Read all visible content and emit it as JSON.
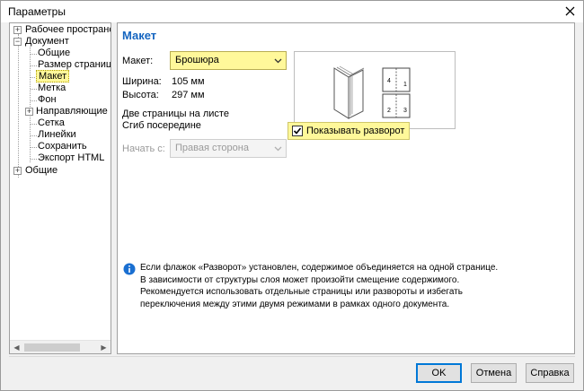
{
  "window": {
    "title": "Параметры"
  },
  "tree": {
    "items": [
      {
        "label": "Рабочее пространство",
        "expander": "+"
      },
      {
        "label": "Документ",
        "expander": "−"
      },
      {
        "label": "Общие"
      },
      {
        "label": "Размер страницы"
      },
      {
        "label": "Макет",
        "selected": true
      },
      {
        "label": "Метка"
      },
      {
        "label": "Фон"
      },
      {
        "label": "Направляющие",
        "expander": "+"
      },
      {
        "label": "Сетка"
      },
      {
        "label": "Линейки"
      },
      {
        "label": "Сохранить"
      },
      {
        "label": "Экспорт HTML"
      },
      {
        "label": "Общие",
        "expander": "+"
      }
    ]
  },
  "main": {
    "title": "Макет",
    "layout_label": "Макет:",
    "layout_value": "Брошюра",
    "width_label": "Ширина:",
    "width_value": "105 мм",
    "height_label": "Высота:",
    "height_value": "297 мм",
    "line1": "Две страницы на листе",
    "line2": "Сгиб посередине",
    "start_label": "Начать с:",
    "start_value": "Правая сторона",
    "show_spread_label": "Показывать разворот",
    "show_spread_checked": true,
    "preview": {
      "p1": "4",
      "p2": "1",
      "p3": "2",
      "p4": "3"
    },
    "info": [
      "Если флажок «Разворот» установлен, содержимое объединяется на одной странице.",
      "В зависимости от структуры слоя может произойти смещение содержимого.",
      "Рекомендуется использовать отдельные страницы или развороты и избегать",
      "переключения между этими двумя режимами в рамках одного документа."
    ]
  },
  "buttons": {
    "ok": "OK",
    "cancel": "Отмена",
    "help": "Справка"
  },
  "colors": {
    "accent_title": "#1565c0",
    "highlight": "#fff89a",
    "info_icon": "#1a6fd1"
  }
}
